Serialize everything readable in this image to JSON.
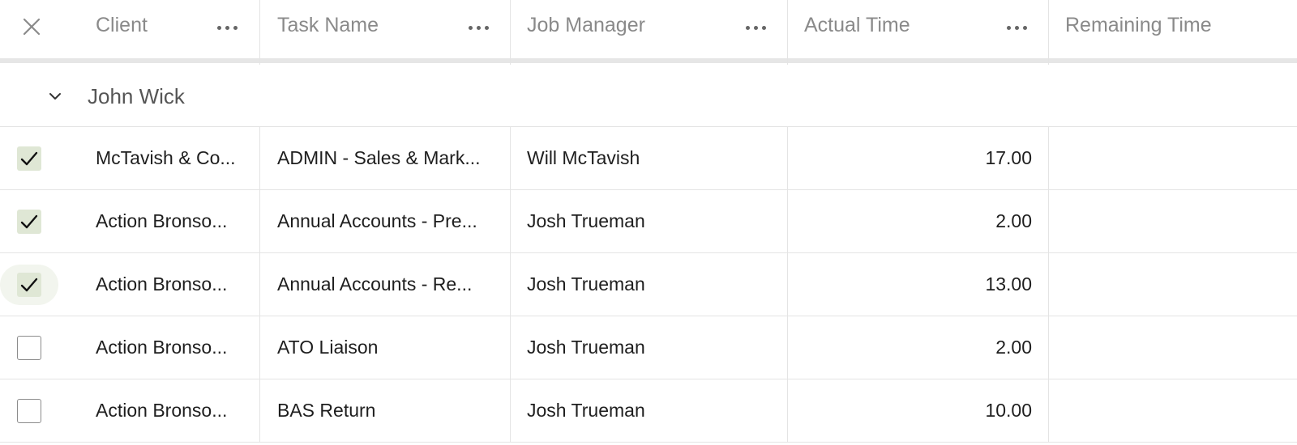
{
  "header": {
    "columns": [
      {
        "key": "client",
        "label": "Client"
      },
      {
        "key": "task",
        "label": "Task Name"
      },
      {
        "key": "manager",
        "label": "Job Manager"
      },
      {
        "key": "actual",
        "label": "Actual Time"
      },
      {
        "key": "remaining",
        "label": "Remaining Time"
      }
    ],
    "icons": {
      "close": "close-icon",
      "menu": "more-horizontal-icon"
    }
  },
  "group": {
    "title": "John Wick",
    "icon": "chevron-down-icon"
  },
  "rows": [
    {
      "checked": true,
      "client": "McTavish & Co...",
      "task": "ADMIN - Sales & Mark...",
      "manager": "Will McTavish",
      "actual": "17.00",
      "remaining": ""
    },
    {
      "checked": true,
      "client": "Action Bronso...",
      "task": "Annual Accounts - Pre...",
      "manager": "Josh Trueman",
      "actual": "2.00",
      "remaining": ""
    },
    {
      "checked": true,
      "client": "Action Bronso...",
      "task": "Annual Accounts - Re...",
      "manager": "Josh Trueman",
      "actual": "13.00",
      "remaining": ""
    },
    {
      "checked": false,
      "client": "Action Bronso...",
      "task": "ATO Liaison",
      "manager": "Josh Trueman",
      "actual": "2.00",
      "remaining": ""
    },
    {
      "checked": false,
      "client": "Action Bronso...",
      "task": "BAS Return",
      "manager": "Josh Trueman",
      "actual": "10.00",
      "remaining": ""
    }
  ],
  "colors": {
    "header_text": "#8a8a8a",
    "cell_text": "#1e1e1e",
    "checkbox_checked_bg": "#dfe7d5",
    "grid_line": "#e4e4e4"
  }
}
